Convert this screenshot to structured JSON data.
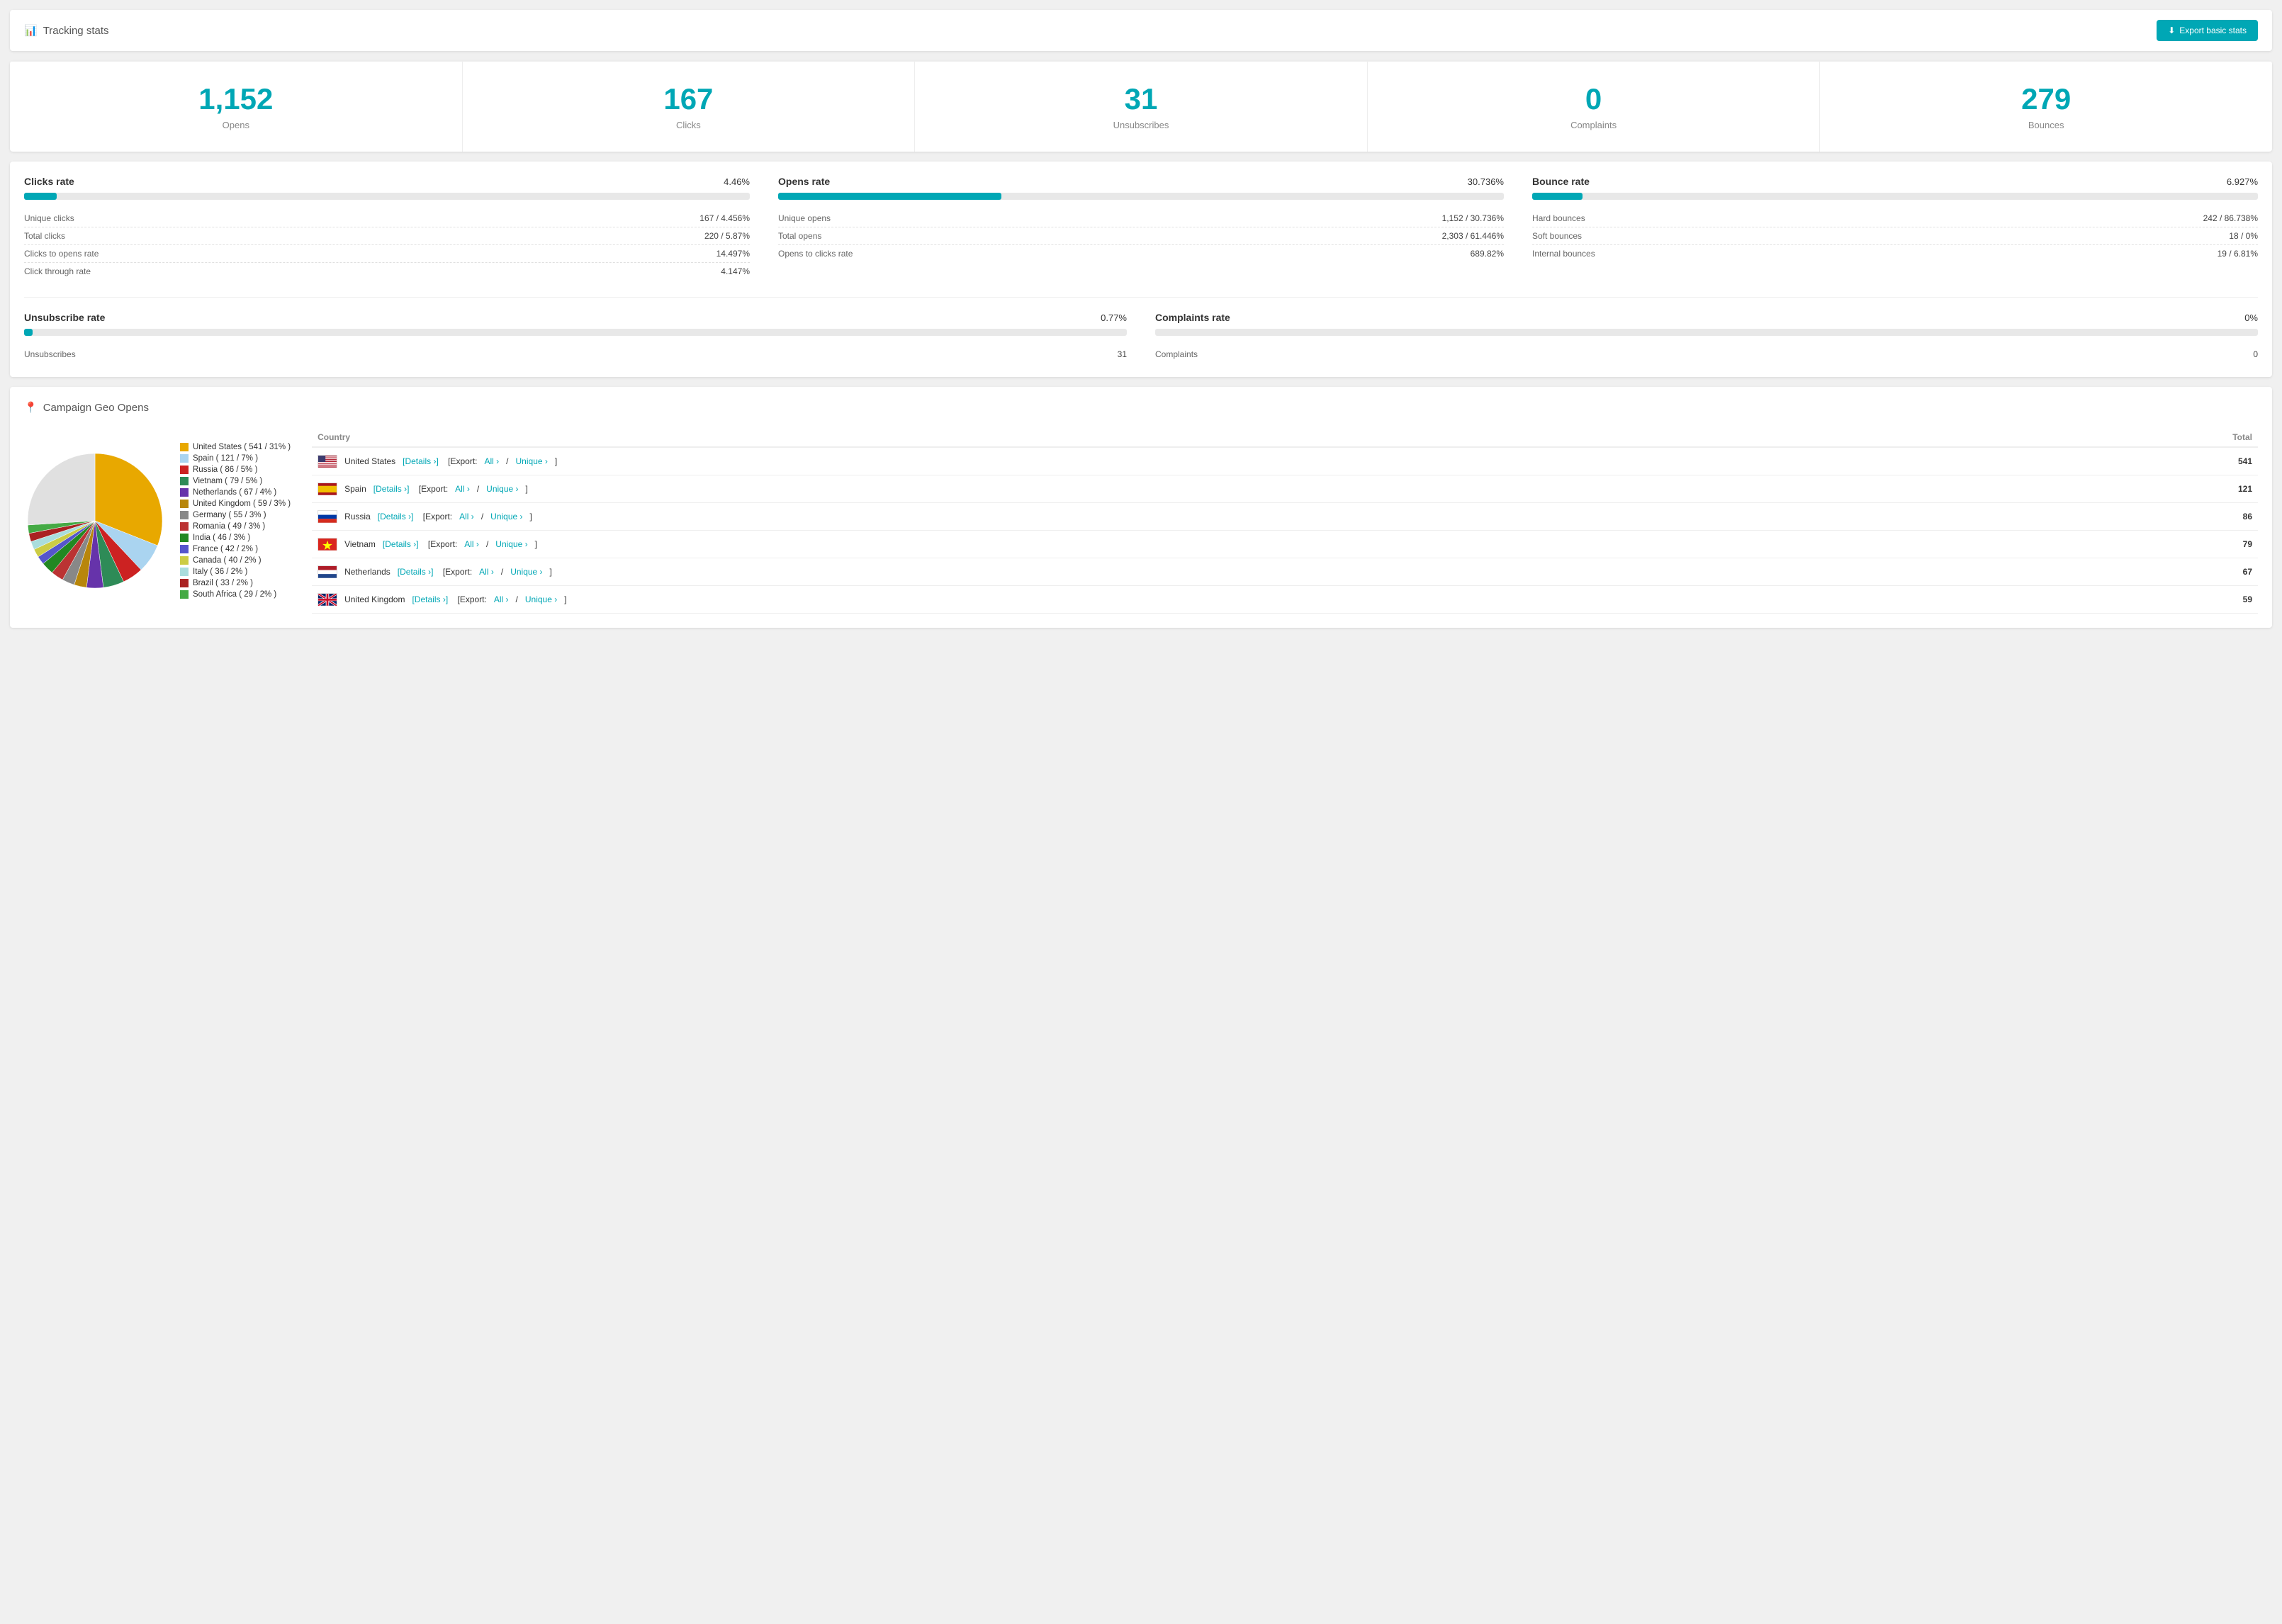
{
  "header": {
    "title": "Tracking stats",
    "export_label": "Export basic stats",
    "icon": "📊"
  },
  "stats": [
    {
      "number": "1,152",
      "label": "Opens"
    },
    {
      "number": "167",
      "label": "Clicks"
    },
    {
      "number": "31",
      "label": "Unsubscribes"
    },
    {
      "number": "0",
      "label": "Complaints"
    },
    {
      "number": "279",
      "label": "Bounces"
    }
  ],
  "rates": {
    "clicks_rate": {
      "title": "Clicks rate",
      "value": "4.46%",
      "fill_pct": 4.46,
      "rows": [
        {
          "label": "Unique clicks",
          "val": "167 / 4.456%"
        },
        {
          "label": "Total clicks",
          "val": "220 / 5.87%"
        },
        {
          "label": "Clicks to opens rate",
          "val": "14.497%"
        },
        {
          "label": "Click through rate",
          "val": "4.147%"
        }
      ]
    },
    "opens_rate": {
      "title": "Opens rate",
      "value": "30.736%",
      "fill_pct": 30.736,
      "rows": [
        {
          "label": "Unique opens",
          "val": "1,152 / 30.736%"
        },
        {
          "label": "Total opens",
          "val": "2,303 / 61.446%"
        },
        {
          "label": "Opens to clicks rate",
          "val": "689.82%"
        }
      ]
    },
    "bounce_rate": {
      "title": "Bounce rate",
      "value": "6.927%",
      "fill_pct": 6.927,
      "rows": [
        {
          "label": "Hard bounces",
          "val": "242 / 86.738%"
        },
        {
          "label": "Soft bounces",
          "val": "18 / 0%"
        },
        {
          "label": "Internal bounces",
          "val": "19 / 6.81%"
        }
      ]
    },
    "unsubscribe_rate": {
      "title": "Unsubscribe rate",
      "value": "0.77%",
      "fill_pct": 0.77,
      "rows": [
        {
          "label": "Unsubscribes",
          "val": "31"
        }
      ]
    },
    "complaints_rate": {
      "title": "Complaints rate",
      "value": "0%",
      "fill_pct": 0,
      "rows": [
        {
          "label": "Complaints",
          "val": "0"
        }
      ]
    }
  },
  "geo": {
    "title": "Campaign Geo Opens",
    "legend": [
      {
        "label": "United States ( 541 / 31% )",
        "color": "#e8a800"
      },
      {
        "label": "Spain ( 121 / 7% )",
        "color": "#aad4f0"
      },
      {
        "label": "Russia ( 86 / 5% )",
        "color": "#cc2222"
      },
      {
        "label": "Vietnam ( 79 / 5% )",
        "color": "#2e8b57"
      },
      {
        "label": "Netherlands ( 67 / 4% )",
        "color": "#6633aa"
      },
      {
        "label": "United Kingdom ( 59 / 3% )",
        "color": "#b8860b"
      },
      {
        "label": "Germany ( 55 / 3% )",
        "color": "#888888"
      },
      {
        "label": "Romania ( 49 / 3% )",
        "color": "#bb3333"
      },
      {
        "label": "India ( 46 / 3% )",
        "color": "#228822"
      },
      {
        "label": "France ( 42 / 2% )",
        "color": "#5555cc"
      },
      {
        "label": "Canada ( 40 / 2% )",
        "color": "#cccc44"
      },
      {
        "label": "Italy ( 36 / 2% )",
        "color": "#aadddd"
      },
      {
        "label": "Brazil ( 33 / 2% )",
        "color": "#aa2222"
      },
      {
        "label": "South Africa ( 29 / 2% )",
        "color": "#44aa44"
      }
    ],
    "table_headers": [
      "Country",
      "Total"
    ],
    "table_rows": [
      {
        "country": "United States",
        "flag": "us",
        "total": "541",
        "details_label": "Details ›",
        "export_all_label": "All ›",
        "export_unique_label": "Unique ›"
      },
      {
        "country": "Spain",
        "flag": "es",
        "total": "121",
        "details_label": "Details ›",
        "export_all_label": "All ›",
        "export_unique_label": "Unique ›"
      },
      {
        "country": "Russia",
        "flag": "ru",
        "total": "86",
        "details_label": "Details ›",
        "export_all_label": "All ›",
        "export_unique_label": "Unique ›"
      },
      {
        "country": "Vietnam",
        "flag": "vn",
        "total": "79",
        "details_label": "Details ›",
        "export_all_label": "All ›",
        "export_unique_label": "Unique ›"
      },
      {
        "country": "Netherlands",
        "flag": "nl",
        "total": "67",
        "details_label": "Details ›",
        "export_all_label": "All ›",
        "export_unique_label": "Unique ›"
      },
      {
        "country": "United Kingdom",
        "flag": "gb",
        "total": "59",
        "details_label": "Details ›",
        "export_all_label": "All ›",
        "export_unique_label": "Unique ›"
      }
    ]
  }
}
